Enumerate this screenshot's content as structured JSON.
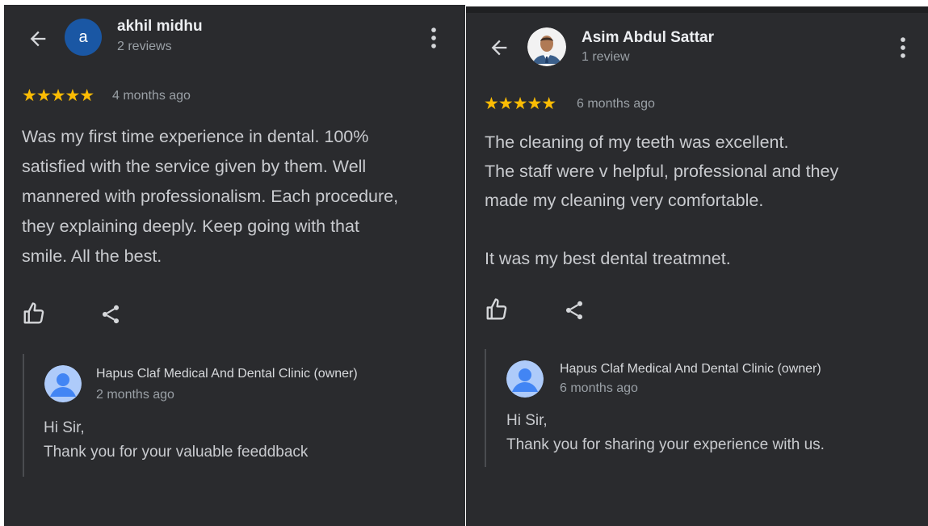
{
  "reviews": [
    {
      "reviewer": {
        "name": "akhil midhu",
        "initial": "a",
        "review_count": "2 reviews"
      },
      "rating": 5,
      "stars": "★★★★★",
      "date": "4 months ago",
      "text": [
        "Was my first time experience in dental. 100%",
        "satisfied with the service given by them. Well",
        "mannered with professionalism. Each procedure,",
        "they explaining deeply. Keep going with that",
        "smile. All the best."
      ],
      "owner_reply": {
        "owner": "Hapus Claf Medical And Dental Clinic (owner)",
        "date": "2 months ago",
        "lines": [
          "Hi Sir,",
          "Thank you for your valuable feeddback"
        ]
      }
    },
    {
      "reviewer": {
        "name": "Asim Abdul Sattar",
        "review_count": "1 review"
      },
      "rating": 5,
      "stars": "★★★★★",
      "date": "6 months ago",
      "text": [
        "The cleaning of my teeth was excellent.",
        "The staff were v helpful, professional and they",
        "made my cleaning very comfortable.",
        "",
        "It was my best dental treatmnet."
      ],
      "owner_reply": {
        "owner": "Hapus Claf Medical And Dental Clinic (owner)",
        "date": "6 months ago",
        "lines": [
          "Hi Sir,",
          "Thank you for sharing your experience with us."
        ]
      }
    }
  ],
  "icons": {
    "back": "arrow-left-icon",
    "more": "more-vert-icon",
    "like": "thumb-up-outline-icon",
    "share": "share-icon",
    "owner_avatar": "default-person-icon"
  },
  "colors": {
    "panel_background": "#2a2b2e",
    "star": "#fbbc04",
    "avatar_letter_bg": "#1a57a4",
    "owner_avatar_bg": "#aecbfa",
    "owner_avatar_fg": "#4285f4",
    "secondary_text": "#9aa0a6"
  }
}
